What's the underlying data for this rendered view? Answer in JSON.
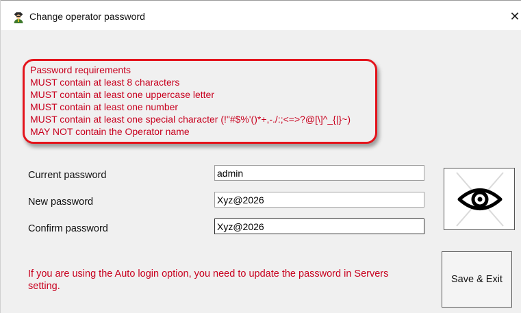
{
  "window": {
    "title": "Change operator password",
    "close_glyph": "✕"
  },
  "requirements": {
    "lines": [
      "Password requirements",
      "MUST contain at least 8 characters",
      "MUST contain at least one uppercase letter",
      "MUST contain at least one number",
      "MUST contain at least one special character (!\"#$%'()*+,-./:;<=>?@[\\]^_{|}~)",
      "MAY NOT contain the Operator name"
    ],
    "text_color": "#c8001e",
    "highlight_border_color": "#e4141c"
  },
  "form": {
    "current_password": {
      "label": "Current password",
      "value": "admin"
    },
    "new_password": {
      "label": "New password",
      "value": "Xyz@2026"
    },
    "confirm_password": {
      "label": "Confirm password",
      "value": "Xyz@2026"
    }
  },
  "show_password_button": {
    "icon": "eye-icon"
  },
  "note": "If you are using the Auto login option, you need to update the password in Servers setting.",
  "save_button": {
    "label": "Save & Exit"
  }
}
